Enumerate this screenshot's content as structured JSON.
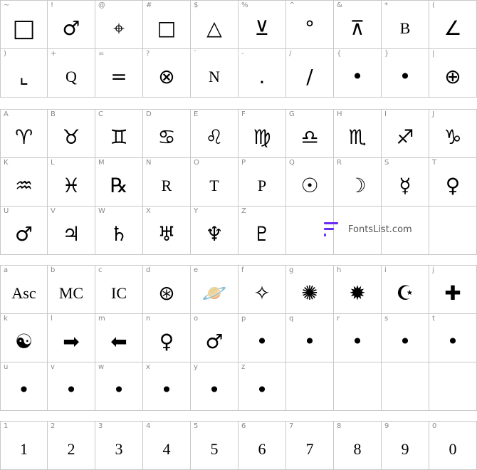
{
  "watermark": {
    "text": "FontsList.com",
    "color": "#6a2cf5"
  },
  "sections": [
    {
      "rows": [
        [
          {
            "key": "~",
            "glyph": "□",
            "icon": "large-square-icon",
            "big": true
          },
          {
            "key": "!",
            "glyph": "♂",
            "icon": "circle-with-line-icon"
          },
          {
            "key": "@",
            "glyph": "⌖",
            "icon": "crosshair-circle-icon"
          },
          {
            "key": "#",
            "glyph": "□",
            "icon": "small-square-icon"
          },
          {
            "key": "$",
            "glyph": "△",
            "icon": "triangle-icon"
          },
          {
            "key": "%",
            "glyph": "⊻",
            "icon": "opposition-v-icon"
          },
          {
            "key": "^",
            "glyph": "°",
            "icon": "degree-icon"
          },
          {
            "key": "&",
            "glyph": "⊼",
            "icon": "t-triangle-icon"
          },
          {
            "key": "*",
            "glyph": "B",
            "icon": "letter-b-icon",
            "text": true
          },
          {
            "key": "(",
            "glyph": "∠",
            "icon": "angle-icon"
          }
        ],
        [
          {
            "key": ")",
            "glyph": "⌞",
            "icon": "square-corner-icon"
          },
          {
            "key": "+",
            "glyph": "Q",
            "icon": "letter-q-icon",
            "text": true
          },
          {
            "key": "=",
            "glyph": "=",
            "icon": "equals-icon"
          },
          {
            "key": "?",
            "glyph": "⊗",
            "icon": "circled-x-icon"
          },
          {
            "key": "`",
            "glyph": "N",
            "icon": "letter-n-icon",
            "text": true
          },
          {
            "key": "-",
            "glyph": ".",
            "icon": "period-icon"
          },
          {
            "key": "/",
            "glyph": "/",
            "icon": "slash-icon"
          },
          {
            "key": "{",
            "glyph": "•",
            "icon": "dot-icon"
          },
          {
            "key": "}",
            "glyph": "•",
            "icon": "dot-icon"
          },
          {
            "key": "|",
            "glyph": "⊕",
            "icon": "earth-symbol-icon"
          }
        ]
      ]
    },
    {
      "rows": [
        [
          {
            "key": "A",
            "glyph": "♈",
            "icon": "aries-icon"
          },
          {
            "key": "B",
            "glyph": "♉",
            "icon": "taurus-icon"
          },
          {
            "key": "C",
            "glyph": "♊",
            "icon": "gemini-icon"
          },
          {
            "key": "D",
            "glyph": "♋",
            "icon": "cancer-icon"
          },
          {
            "key": "E",
            "glyph": "♌",
            "icon": "leo-icon"
          },
          {
            "key": "F",
            "glyph": "♍",
            "icon": "virgo-icon"
          },
          {
            "key": "G",
            "glyph": "♎",
            "icon": "libra-icon"
          },
          {
            "key": "H",
            "glyph": "♏",
            "icon": "scorpio-icon"
          },
          {
            "key": "I",
            "glyph": "♐",
            "icon": "sagittarius-icon"
          },
          {
            "key": "J",
            "glyph": "♑",
            "icon": "capricorn-icon"
          }
        ],
        [
          {
            "key": "K",
            "glyph": "♒",
            "icon": "aquarius-icon"
          },
          {
            "key": "L",
            "glyph": "♓",
            "icon": "pisces-icon"
          },
          {
            "key": "M",
            "glyph": "℞",
            "icon": "retrograde-icon"
          },
          {
            "key": "N",
            "glyph": "R",
            "icon": "letter-r-icon",
            "text": true
          },
          {
            "key": "O",
            "glyph": "T",
            "icon": "letter-t-icon",
            "text": true
          },
          {
            "key": "P",
            "glyph": "P",
            "icon": "letter-p-icon",
            "text": true
          },
          {
            "key": "Q",
            "glyph": "☉",
            "icon": "sun-icon"
          },
          {
            "key": "R",
            "glyph": "☽",
            "icon": "moon-icon"
          },
          {
            "key": "S",
            "glyph": "☿",
            "icon": "mercury-icon"
          },
          {
            "key": "T",
            "glyph": "♀",
            "icon": "venus-icon"
          }
        ],
        [
          {
            "key": "U",
            "glyph": "♂",
            "icon": "mars-icon"
          },
          {
            "key": "V",
            "glyph": "♃",
            "icon": "jupiter-icon"
          },
          {
            "key": "W",
            "glyph": "♄",
            "icon": "saturn-icon"
          },
          {
            "key": "X",
            "glyph": "♅",
            "icon": "uranus-icon"
          },
          {
            "key": "Y",
            "glyph": "♆",
            "icon": "neptune-icon"
          },
          {
            "key": "Z",
            "glyph": "♇",
            "icon": "pluto-icon"
          },
          {
            "key": "",
            "glyph": "",
            "icon": "empty"
          },
          {
            "key": "",
            "glyph": "",
            "icon": "empty"
          },
          {
            "key": "",
            "glyph": "",
            "icon": "empty"
          },
          {
            "key": "",
            "glyph": "",
            "icon": "empty"
          }
        ]
      ]
    },
    {
      "rows": [
        [
          {
            "key": "a",
            "glyph": "Asc",
            "icon": "ascendant-label",
            "text": true
          },
          {
            "key": "b",
            "glyph": "MC",
            "icon": "midheaven-label",
            "text": true
          },
          {
            "key": "c",
            "glyph": "IC",
            "icon": "imum-coeli-label",
            "text": true
          },
          {
            "key": "d",
            "glyph": "⊛",
            "icon": "wheel-icon"
          },
          {
            "key": "e",
            "glyph": "🪐",
            "icon": "ringed-planet-icon"
          },
          {
            "key": "f",
            "glyph": "✧",
            "icon": "four-point-star-icon"
          },
          {
            "key": "g",
            "glyph": "✺",
            "icon": "sunburst-outline-icon"
          },
          {
            "key": "h",
            "glyph": "✹",
            "icon": "sunburst-solid-icon"
          },
          {
            "key": "i",
            "glyph": "☪",
            "icon": "crescent-star-icon"
          },
          {
            "key": "j",
            "glyph": "✚",
            "icon": "circled-cross-icon"
          }
        ],
        [
          {
            "key": "k",
            "glyph": "☯",
            "icon": "yin-yang-icon"
          },
          {
            "key": "l",
            "glyph": "➡",
            "icon": "arrow-right-icon"
          },
          {
            "key": "m",
            "glyph": "⬅",
            "icon": "arrow-left-icon"
          },
          {
            "key": "n",
            "glyph": "♀",
            "icon": "female-icon"
          },
          {
            "key": "o",
            "glyph": "♂",
            "icon": "male-icon"
          },
          {
            "key": "p",
            "glyph": "•",
            "icon": "dot-icon"
          },
          {
            "key": "q",
            "glyph": "•",
            "icon": "dot-icon"
          },
          {
            "key": "r",
            "glyph": "•",
            "icon": "dot-icon"
          },
          {
            "key": "s",
            "glyph": "•",
            "icon": "dot-icon"
          },
          {
            "key": "t",
            "glyph": "•",
            "icon": "dot-icon"
          }
        ],
        [
          {
            "key": "u",
            "glyph": "•",
            "icon": "dot-icon"
          },
          {
            "key": "v",
            "glyph": "•",
            "icon": "dot-icon"
          },
          {
            "key": "w",
            "glyph": "•",
            "icon": "dot-icon"
          },
          {
            "key": "x",
            "glyph": "•",
            "icon": "dot-icon"
          },
          {
            "key": "y",
            "glyph": "•",
            "icon": "dot-icon"
          },
          {
            "key": "z",
            "glyph": "•",
            "icon": "dot-icon"
          },
          {
            "key": "",
            "glyph": "",
            "icon": "empty"
          },
          {
            "key": "",
            "glyph": "",
            "icon": "empty"
          },
          {
            "key": "",
            "glyph": "",
            "icon": "empty"
          },
          {
            "key": "",
            "glyph": "",
            "icon": "empty"
          }
        ]
      ]
    },
    {
      "rows": [
        [
          {
            "key": "1",
            "glyph": "1",
            "icon": "digit-1",
            "text": true
          },
          {
            "key": "2",
            "glyph": "2",
            "icon": "digit-2",
            "text": true
          },
          {
            "key": "3",
            "glyph": "3",
            "icon": "digit-3",
            "text": true
          },
          {
            "key": "4",
            "glyph": "4",
            "icon": "digit-4",
            "text": true
          },
          {
            "key": "5",
            "glyph": "5",
            "icon": "digit-5",
            "text": true
          },
          {
            "key": "6",
            "glyph": "6",
            "icon": "digit-6",
            "text": true
          },
          {
            "key": "7",
            "glyph": "7",
            "icon": "digit-7",
            "text": true
          },
          {
            "key": "8",
            "glyph": "8",
            "icon": "digit-8",
            "text": true
          },
          {
            "key": "9",
            "glyph": "9",
            "icon": "digit-9",
            "text": true
          },
          {
            "key": "0",
            "glyph": "0",
            "icon": "digit-0",
            "text": true
          }
        ]
      ]
    }
  ]
}
